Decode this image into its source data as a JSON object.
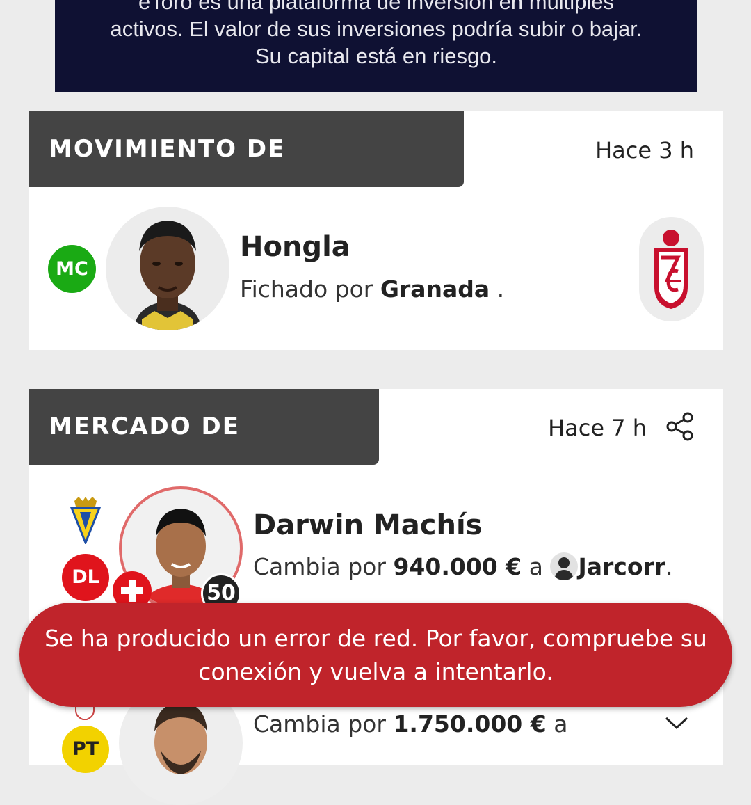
{
  "ad": {
    "line1": "eToro es una plataforma de inversión en múltiples",
    "line2": "activos. El valor de sus inversiones podría subir o bajar.",
    "line3": "Su capital está en riesgo."
  },
  "player_movement": {
    "title": "MOVIMIENTO DE JUGADORES",
    "time": "Hace 3 h",
    "position": "MC",
    "position_color": "#1aaa14",
    "player": "Hongla",
    "text_prefix": "Fichado por",
    "club": "Granada",
    "text_suffix": "."
  },
  "market": {
    "title": "MERCADO DE FICHAJES",
    "time": "Hace 7 h",
    "share_icon": "share-icon",
    "items": [
      {
        "position": "DL",
        "position_color": "#e0141c",
        "player": "Darwin Machís",
        "text_prefix": "Cambia por",
        "price": "940.000 €",
        "text_mid": "a",
        "manager": "Jarcorr",
        "text_suffix": ".",
        "points": "50"
      },
      {
        "position": "PT",
        "position_color": "#f2d200",
        "text_prefix": "Cambia por",
        "price": "1.750.000 €",
        "text_mid": "a"
      }
    ]
  },
  "toast": {
    "line1": "Se ha producido un error de red. Por favor, compruebe su",
    "line2": "conexión y vuelva a intentarlo."
  },
  "colors": {
    "header": "#444444",
    "toast": "#c0242b",
    "ad_bg": "#0f1133"
  }
}
